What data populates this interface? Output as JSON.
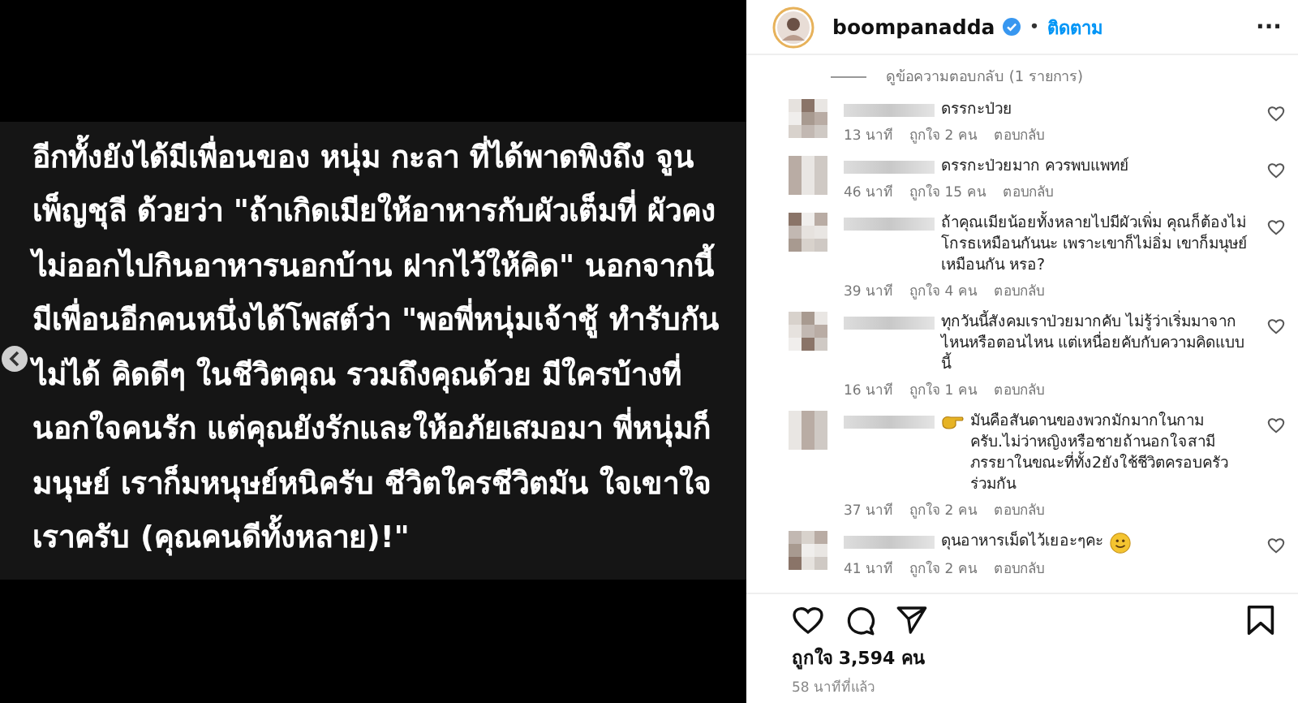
{
  "post": {
    "lines": [
      "อีกทั้งยังได้มีเพื่อนของ หนุ่ม กะลา ที่ได้พาดพิงถึง จูน",
      "เพ็ญชุลี ด้วยว่า \"ถ้าเกิดเมียให้อาหารกับผัวเต็มที่ ผัวคง",
      "ไม่ออกไปกินอาหารนอกบ้าน ฝากไว้ให้คิด\" นอกจากนี้",
      "มีเพื่อนอีกคนหนึ่งได้โพสต์ว่า \"พอพี่หนุ่มเจ้าชู้ ทำรับกัน",
      "ไม่ได้ คิดดีๆ ในชีวิตคุณ รวมถึงคุณด้วย มีใครบ้างที่",
      "นอกใจคนรัก แต่คุณยังรักและให้อภัยเสมอมา พี่หนุ่มก็",
      "มนุษย์ เราก็มหนุษย์หนิครับ ชีวิตใครชีวิตมัน ใจเขาใจ",
      "เราครับ (คุณคนดีทั้งหลาย)!\""
    ]
  },
  "header": {
    "username": "boompanadda",
    "verified": true,
    "separator": "•",
    "follow": "ติดตาม",
    "more": "···"
  },
  "view_replies": "ดูข้อความตอบกลับ (1 รายการ)",
  "comments": [
    {
      "kind": "plain",
      "text": "ดรรกะป่วย",
      "time": "13 นาที",
      "likes": "ถูกใจ 2 คน",
      "reply": "ตอบกลับ"
    },
    {
      "kind": "plain",
      "text": "ดรรกะป่วยมาก ควรพบแพทย์",
      "time": "46 นาที",
      "likes": "ถูกใจ 15 คน",
      "reply": "ตอบกลับ"
    },
    {
      "kind": "plain",
      "text": "ถ้าคุณเมียน้อยทั้งหลายไปมีผัวเพิ่ม คุณก็ต้องไม่โกรธเหมือนกันนะ เพราะเขาก็ไม่อิ่ม เขาก็มนุษย์เหมือนกัน หรอ?",
      "time": "39 นาที",
      "likes": "ถูกใจ 4 คน",
      "reply": "ตอบกลับ"
    },
    {
      "kind": "plain",
      "text": "ทุกวันนี้สังคมเราป่วยมากคับ ไม่รู้ว่าเริ่มมาจากไหนหรือตอนไหน แต่เหนื่อยคับกับความคิดแบบนี้",
      "time": "16 นาที",
      "likes": "ถูกใจ 1 คน",
      "reply": "ตอบกลับ"
    },
    {
      "kind": "lead-emoji",
      "text": "มันคือสันดานของพวกมักมากในกามครับ.ไม่ว่าหญิงหรือชายถ้านอกใจสามีภรรยาในขณะที่ทั้ง2ยังใช้ชีวิตครอบครัวร่วมกัน",
      "time": "37 นาที",
      "likes": "ถูกใจ 2 คน",
      "reply": "ตอบกลับ"
    },
    {
      "kind": "trail-emoji",
      "text": "ดุนอาหารเม็ดไว้เยอะๆคะ",
      "time": "41 นาที",
      "likes": "ถูกใจ 2 คน",
      "reply": "ตอบกลับ"
    }
  ],
  "likes": "ถูกใจ 3,594 คน",
  "posted": "58 นาทีที่แล้ว"
}
